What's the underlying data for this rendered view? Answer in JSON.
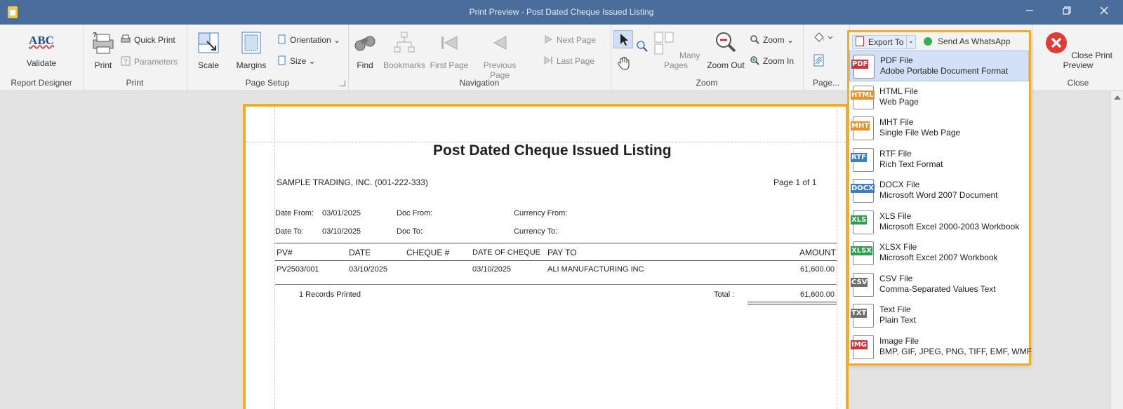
{
  "window": {
    "title": "Print Preview - Post Dated Cheque Issued Listing"
  },
  "ribbon": {
    "report_designer": {
      "validate_abc": "ABC",
      "validate": "Validate",
      "group": "Report Designer"
    },
    "print": {
      "print": "Print",
      "quick_print": "Quick Print",
      "parameters": "Parameters",
      "group": "Print"
    },
    "page_setup": {
      "scale": "Scale",
      "margins": "Margins",
      "orientation": "Orientation",
      "size": "Size",
      "group": "Page Setup"
    },
    "navigation": {
      "find": "Find",
      "bookmarks": "Bookmarks",
      "first_page": "First Page",
      "previous_page": "Previous Page",
      "next_page": "Next Page",
      "last_page": "Last Page",
      "group": "Navigation"
    },
    "zoom": {
      "many_pages": "Many Pages",
      "zoom_out": "Zoom Out",
      "zoom": "Zoom",
      "zoom_in": "Zoom In",
      "group": "Zoom"
    },
    "page_background": {
      "group": "Page..."
    },
    "export": {
      "export_to": "Export To",
      "send_whatsapp": "Send As WhatsApp"
    },
    "close": {
      "close_preview": "Close Print Preview",
      "group": "Close"
    }
  },
  "report": {
    "title": "Post Dated Cheque Issued Listing",
    "company": "SAMPLE TRADING, INC. (001-222-333)",
    "page": "Page 1 of 1",
    "filters": {
      "date_from_label": "Date From:",
      "date_from": "03/01/2025",
      "date_to_label": "Date To:",
      "date_to": "03/10/2025",
      "doc_from_label": "Doc From:",
      "doc_to_label": "Doc To:",
      "currency_from_label": "Currency From:",
      "currency_to_label": "Currency To:"
    },
    "columns": {
      "pv": "PV#",
      "date": "DATE",
      "cheque": "CHEQUE #",
      "date_of_cheque": "DATE OF CHEQUE",
      "pay_to": "PAY TO",
      "amount": "AMOUNT"
    },
    "rows": [
      {
        "pv": "PV2503/001",
        "date": "03/10/2025",
        "cheque": "",
        "date_of_cheque": "03/10/2025",
        "pay_to": "ALI MANUFACTURING INC",
        "amount": "61,600.00"
      }
    ],
    "records_printed": "1 Records Printed",
    "total_label": "Total :",
    "total": "61,600.00"
  },
  "export_menu": [
    {
      "tag": "PDF",
      "color": "#d13438",
      "name": "PDF File",
      "desc": "Adobe Portable Document Format"
    },
    {
      "tag": "HTML",
      "color": "#e8912d",
      "name": "HTML File",
      "desc": "Web Page"
    },
    {
      "tag": "MHT",
      "color": "#e8912d",
      "name": "MHT File",
      "desc": "Single File Web Page"
    },
    {
      "tag": "RTF",
      "color": "#3c7dc6",
      "name": "RTF File",
      "desc": "Rich Text Format"
    },
    {
      "tag": "DOCX",
      "color": "#3c7dc6",
      "name": "DOCX File",
      "desc": "Microsoft Word 2007 Document"
    },
    {
      "tag": "XLS",
      "color": "#2f9e4f",
      "name": "XLS File",
      "desc": "Microsoft Excel 2000-2003 Workbook"
    },
    {
      "tag": "XLSX",
      "color": "#2f9e4f",
      "name": "XLSX File",
      "desc": "Microsoft Excel 2007 Workbook"
    },
    {
      "tag": "CSV",
      "color": "#6e6e6e",
      "name": "CSV File",
      "desc": "Comma-Separated Values Text"
    },
    {
      "tag": "TXT",
      "color": "#6e6e6e",
      "name": "Text File",
      "desc": "Plain Text"
    },
    {
      "tag": "IMG",
      "color": "#d13438",
      "name": "Image File",
      "desc": "BMP, GIF, JPEG, PNG, TIFF, EMF, WMF"
    }
  ]
}
